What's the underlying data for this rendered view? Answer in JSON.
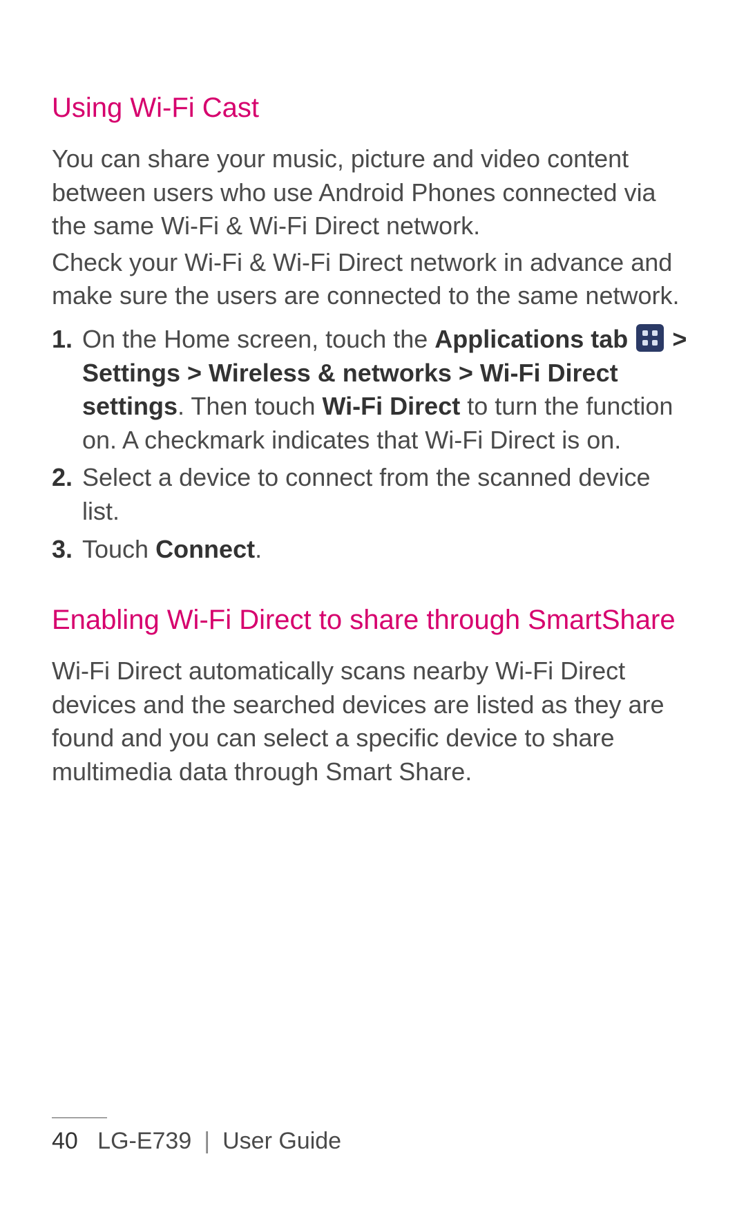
{
  "section1": {
    "heading": "Using Wi-Fi Cast",
    "para1": "You can share your music, picture and video content between users who use Android Phones connected via the same Wi-Fi & Wi-Fi Direct network.",
    "para2": "Check your Wi-Fi & Wi-Fi Direct network in advance and make sure the users are connected to the same network.",
    "steps": {
      "num1": "1.",
      "s1_a": "On the Home screen, touch the ",
      "s1_b": "Applications tab",
      "s1_c": " > ",
      "s1_d": "Settings",
      "s1_e": " > ",
      "s1_f": "Wireless & networks",
      "s1_g": " > ",
      "s1_h": "Wi-Fi Direct settings",
      "s1_i": ". Then touch ",
      "s1_j": "Wi-Fi Direct",
      "s1_k": " to turn the function on. A checkmark indicates that Wi-Fi Direct is on.",
      "num2": "2.",
      "s2": "Select a device to connect from the scanned device list.",
      "num3": "3.",
      "s3_a": "Touch ",
      "s3_b": "Connect",
      "s3_c": "."
    }
  },
  "section2": {
    "heading": "Enabling Wi-Fi Direct to share through SmartShare",
    "para": "Wi-Fi Direct automatically scans nearby Wi-Fi Direct devices and the searched devices are listed as they are found and you can select a specific device to share multimedia data through Smart Share."
  },
  "footer": {
    "page": "40",
    "model": "LG-E739",
    "divider": "|",
    "title": "User Guide"
  }
}
